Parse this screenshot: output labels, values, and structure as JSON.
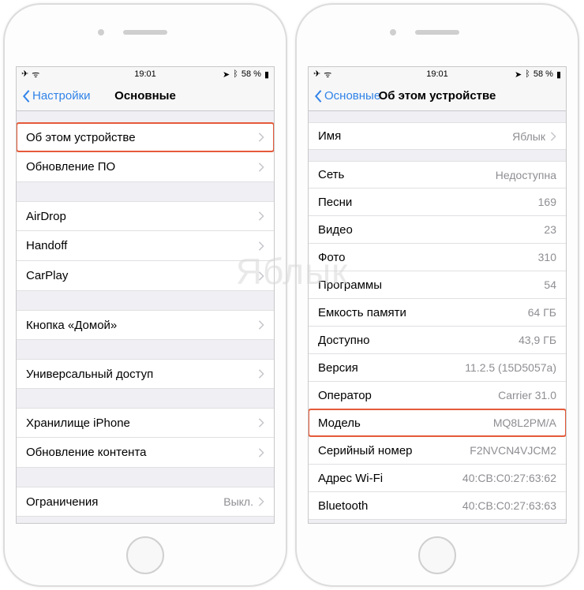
{
  "watermark": "Яблык",
  "status": {
    "time": "19:01",
    "battery": "58 %"
  },
  "left": {
    "back": "Настройки",
    "title": "Основные",
    "g1": [
      {
        "label": "Об этом устройстве"
      },
      {
        "label": "Обновление ПО"
      }
    ],
    "g2": [
      {
        "label": "AirDrop"
      },
      {
        "label": "Handoff"
      },
      {
        "label": "CarPlay"
      }
    ],
    "g3": [
      {
        "label": "Кнопка «Домой»"
      }
    ],
    "g4": [
      {
        "label": "Универсальный доступ"
      }
    ],
    "g5": [
      {
        "label": "Хранилище iPhone"
      },
      {
        "label": "Обновление контента"
      }
    ],
    "g6": [
      {
        "label": "Ограничения",
        "value": "Выкл."
      }
    ]
  },
  "right": {
    "back": "Основные",
    "title": "Об этом устройстве",
    "g1": [
      {
        "label": "Имя",
        "value": "Яблык",
        "chev": true
      }
    ],
    "g2": [
      {
        "label": "Сеть",
        "value": "Недоступна"
      },
      {
        "label": "Песни",
        "value": "169"
      },
      {
        "label": "Видео",
        "value": "23"
      },
      {
        "label": "Фото",
        "value": "310"
      },
      {
        "label": "Программы",
        "value": "54"
      },
      {
        "label": "Емкость памяти",
        "value": "64 ГБ"
      },
      {
        "label": "Доступно",
        "value": "43,9 ГБ"
      },
      {
        "label": "Версия",
        "value": "11.2.5 (15D5057a)"
      },
      {
        "label": "Оператор",
        "value": "Carrier 31.0"
      },
      {
        "label": "Модель",
        "value": "MQ8L2PM/A",
        "hl": true
      },
      {
        "label": "Серийный номер",
        "value": "F2NVCN4VJCM2"
      },
      {
        "label": "Адрес Wi-Fi",
        "value": "40:CB:C0:27:63:62"
      },
      {
        "label": "Bluetooth",
        "value": "40:CB:C0:27:63:63"
      }
    ]
  }
}
